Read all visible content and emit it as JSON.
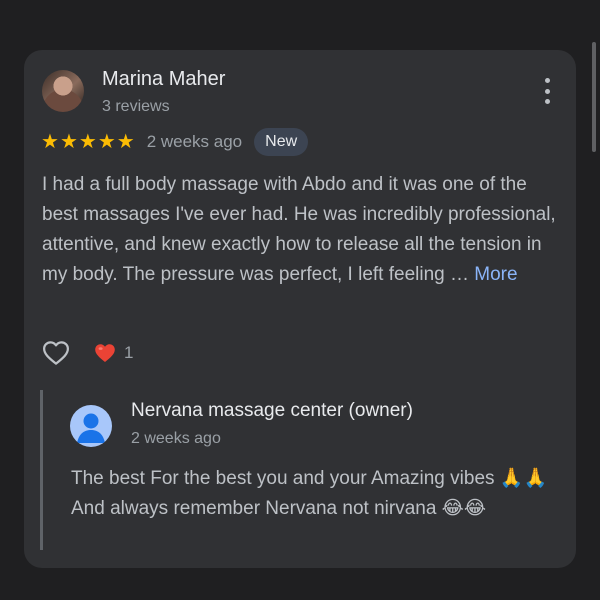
{
  "review": {
    "reviewer_name": "Marina Maher",
    "reviewer_meta": "3 reviews",
    "rating": 5,
    "stars": [
      "★",
      "★",
      "★",
      "★",
      "★"
    ],
    "time": "2 weeks ago",
    "badge": "New",
    "text": "I had a full body massage with Abdo and it was one of the best massages I've ever had. He was incredibly professional, attentive, and knew exactly how to release all the tension in my body. The pressure was perfect, I left feeling …",
    "more_label": "More",
    "menu_icon": "more-vert-icon"
  },
  "actions": {
    "like_icon": "heart-outline-icon",
    "reaction_icon": "red-heart-icon",
    "reaction_count": "1"
  },
  "owner_response": {
    "name": "Nervana massage center (owner)",
    "time": "2 weeks ago",
    "text_line1": "The best For the best you and your Amazing vibes 🙏🙏",
    "text_line2": "And always remember Nervana not nirvana 😂😂",
    "avatar_icon": "person-avatar-icon"
  },
  "colors": {
    "star": "#fbbc04",
    "link": "#8ab4f8",
    "card_bg": "#303134",
    "page_bg": "#1f1f21",
    "heart": "#ea4335"
  }
}
